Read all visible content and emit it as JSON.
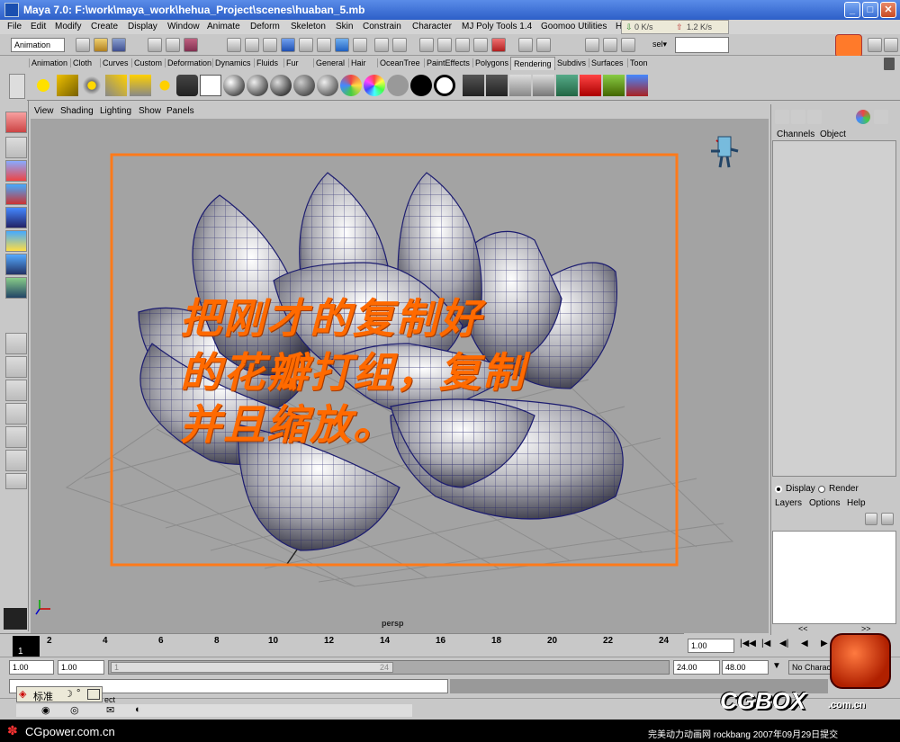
{
  "window": {
    "title": "Maya 7.0: F:\\work\\maya_work\\hehua_Project\\scenes\\huaban_5.mb"
  },
  "menubar": [
    "File",
    "Edit",
    "Modify",
    "Create",
    "Display",
    "Window",
    "Animate",
    "Deform",
    "Skeleton",
    "Skin",
    "Constrain",
    "Character",
    "MJ Poly Tools 1.4",
    "Goomoo Utilities",
    "H"
  ],
  "net": {
    "down": "0 K/s",
    "up": "1.2 K/s"
  },
  "statusline": {
    "menuset": "Animation",
    "sel_label": "sel▾"
  },
  "shelf_tabs": [
    "Animation",
    "Cloth",
    "Curves",
    "Custom",
    "Deformation",
    "Dynamics",
    "Fluids",
    "Fur",
    "General",
    "Hair",
    "OceanTree",
    "PaintEffects",
    "Polygons",
    "Rendering",
    "Subdivs",
    "Surfaces",
    "Toon"
  ],
  "active_shelf_tab": "Rendering",
  "viewport": {
    "menu": [
      "View",
      "Shading",
      "Lighting",
      "Show",
      "Panels"
    ],
    "camera": "persp",
    "overlay_lines": [
      "把刚才的复制好",
      "的花瓣打组，复制",
      "并且缩放。"
    ]
  },
  "channelbox": {
    "tabs": [
      "Channels",
      "Object"
    ]
  },
  "layer_editor": {
    "modes": [
      "Display",
      "Render"
    ],
    "menu": [
      "Layers",
      "Options",
      "Help"
    ],
    "nav": [
      "<<",
      ">>"
    ]
  },
  "timeline": {
    "current_frame": "1",
    "ticks": [
      "2",
      "4",
      "6",
      "8",
      "10",
      "12",
      "14",
      "16",
      "18",
      "20",
      "22",
      "24"
    ],
    "current_time_field": "1.00"
  },
  "range": {
    "start": "1.00",
    "playback_start": "1.00",
    "slider_left": "1",
    "slider_right": "24",
    "playback_end": "24.00",
    "end": "48.00",
    "character": "No Charac"
  },
  "cmdline": {
    "ime": "标准",
    "mel_label": "ect"
  },
  "footer": {
    "left": "CGpower.com.cn",
    "right": "完美动力动画网 rockbang 2007年09月29日提交",
    "logo": "CGBOX",
    "logo_sub": ".com.cn"
  },
  "colors": {
    "overlay": "#ff6a00",
    "viewport_bg": "#a3a3a3",
    "title": "#2d5fc8"
  }
}
